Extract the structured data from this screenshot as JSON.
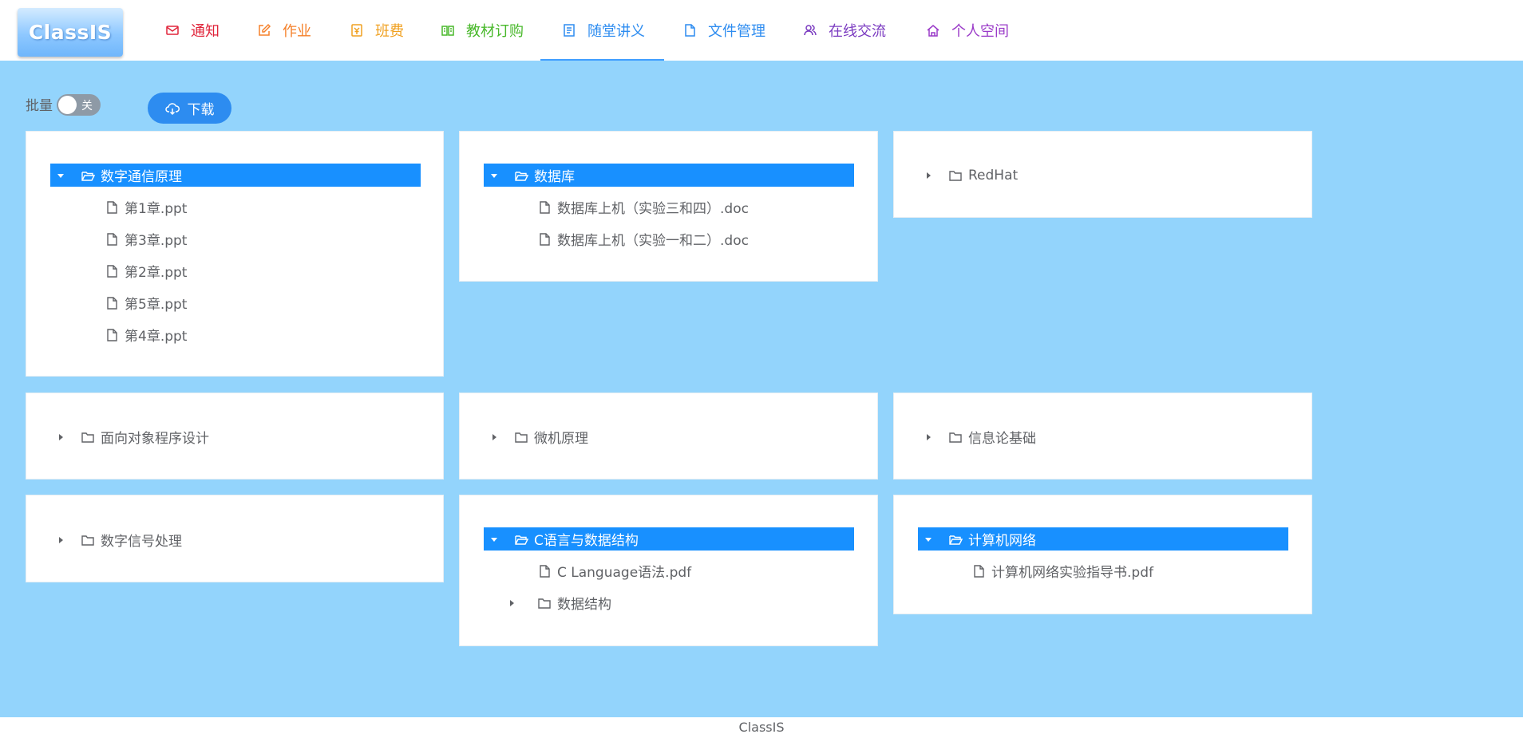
{
  "app": {
    "logo_text": "ClassIS",
    "footer": "ClassIS"
  },
  "nav": [
    {
      "label": "通知",
      "icon": "mail-icon",
      "color": "#e0243a"
    },
    {
      "label": "作业",
      "icon": "edit-icon",
      "color": "#f5802a"
    },
    {
      "label": "班费",
      "icon": "money-icon",
      "color": "#f0a020"
    },
    {
      "label": "教材订购",
      "icon": "book-icon",
      "color": "#48b82a"
    },
    {
      "label": "随堂讲义",
      "icon": "notes-icon",
      "color": "#2d8cf0",
      "active": true
    },
    {
      "label": "文件管理",
      "icon": "document-icon",
      "color": "#2d8cf0"
    },
    {
      "label": "在线交流",
      "icon": "chat-users-icon",
      "color": "#7a3ac0"
    },
    {
      "label": "个人空间",
      "icon": "home-icon",
      "color": "#9a3ac8"
    }
  ],
  "toolbar": {
    "batch_label": "批量",
    "switch_text": "关",
    "batch_on": false,
    "download_label": "下载"
  },
  "trees": [
    {
      "name": "数字通信原理",
      "expanded": true,
      "selected": true,
      "children": [
        {
          "name": "第1章.ppt",
          "type": "file"
        },
        {
          "name": "第3章.ppt",
          "type": "file"
        },
        {
          "name": "第2章.ppt",
          "type": "file"
        },
        {
          "name": "第5章.ppt",
          "type": "file"
        },
        {
          "name": "第4章.ppt",
          "type": "file"
        }
      ]
    },
    {
      "name": "数据库",
      "expanded": true,
      "selected": true,
      "children": [
        {
          "name": "数据库上机（实验三和四）.doc",
          "type": "file"
        },
        {
          "name": "数据库上机（实验一和二）.doc",
          "type": "file"
        }
      ]
    },
    {
      "name": "RedHat",
      "expanded": false,
      "selected": false,
      "children": []
    },
    {
      "name": "面向对象程序设计",
      "expanded": false,
      "selected": false,
      "children": []
    },
    {
      "name": "微机原理",
      "expanded": false,
      "selected": false,
      "children": []
    },
    {
      "name": "信息论基础",
      "expanded": false,
      "selected": false,
      "children": []
    },
    {
      "name": "数字信号处理",
      "expanded": false,
      "selected": false,
      "children": []
    },
    {
      "name": "C语言与数据结构",
      "expanded": true,
      "selected": true,
      "children": [
        {
          "name": "C Language语法.pdf",
          "type": "file"
        },
        {
          "name": "数据结构",
          "type": "folder"
        }
      ]
    },
    {
      "name": "计算机网络",
      "expanded": true,
      "selected": true,
      "children": [
        {
          "name": "计算机网络实验指导书.pdf",
          "type": "file"
        }
      ]
    }
  ]
}
